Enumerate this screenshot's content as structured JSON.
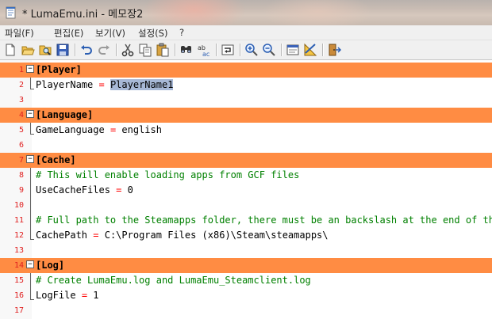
{
  "window": {
    "title": "* LumaEmu.ini - 메모장2"
  },
  "menu": {
    "items": [
      "파일(F)",
      "편집(E)",
      "보기(V)",
      "설정(S)",
      "?"
    ]
  },
  "toolbar": {
    "buttons": [
      "new-file-icon",
      "open-file-icon",
      "browse-icon",
      "save-icon",
      "undo-icon",
      "redo-icon",
      "cut-icon",
      "copy-icon",
      "paste-icon",
      "find-icon",
      "replace-icon",
      "word-wrap-icon",
      "zoom-in-icon",
      "zoom-out-icon",
      "scheme-icon",
      "customize-icon",
      "exit-icon"
    ]
  },
  "editor": {
    "section_color": "#ff8c43",
    "comment_color": "#008000",
    "line_number_color": "#e02020",
    "selected_text": "PlayerName1",
    "lines": [
      {
        "n": "1",
        "text": "[Player]"
      },
      {
        "n": "2",
        "key": "PlayerName",
        "op": "=",
        "value": "PlayerName1"
      },
      {
        "n": "3",
        "text": ""
      },
      {
        "n": "4",
        "text": "[Language]"
      },
      {
        "n": "5",
        "key": "GameLanguage",
        "op": "=",
        "value": "english"
      },
      {
        "n": "6",
        "text": ""
      },
      {
        "n": "7",
        "text": "[Cache]"
      },
      {
        "n": "8",
        "text": "# This will enable loading apps from GCF files"
      },
      {
        "n": "9",
        "key": "UseCacheFiles",
        "op": "=",
        "value": "0"
      },
      {
        "n": "10",
        "text": ""
      },
      {
        "n": "11",
        "text": "# Full path to the Steamapps folder, there must be an backslash at the end of the"
      },
      {
        "n": "12",
        "key": "CachePath",
        "op": "=",
        "value": "C:\\Program Files (x86)\\Steam\\steamapps\\"
      },
      {
        "n": "13",
        "text": ""
      },
      {
        "n": "14",
        "text": "[Log]"
      },
      {
        "n": "15",
        "text": "# Create LumaEmu.log and LumaEmu_Steamclient.log"
      },
      {
        "n": "16",
        "key": "LogFile",
        "op": "=",
        "value": "1"
      },
      {
        "n": "17",
        "text": ""
      }
    ]
  }
}
